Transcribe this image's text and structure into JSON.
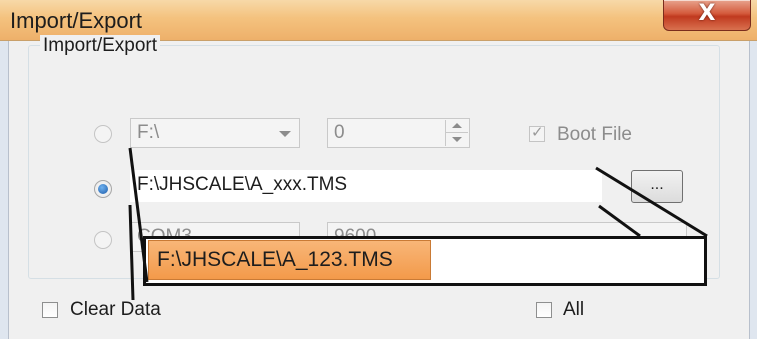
{
  "window": {
    "title": "Import/Export",
    "close_label": "X"
  },
  "group": {
    "label": "Import/Export"
  },
  "row1": {
    "drive_value": "F:\\",
    "number_value": "0",
    "boot_file_label": "Boot File",
    "boot_file_checked": true
  },
  "row2": {
    "path_value": "F:\\JHSCALE\\A_xxx.TMS",
    "browse_label": "..."
  },
  "row3": {
    "port_value": "COM3",
    "baud_value": "9600"
  },
  "callout": {
    "text": "F:\\JHSCALE\\A_123.TMS",
    "highlight_color": "#f5a65b"
  },
  "footer": {
    "clear_data_label": "Clear Data",
    "all_label": "All"
  },
  "colors": {
    "titlebar": "#f4c27e",
    "close_button": "#c0391f",
    "radio_selected": "#1d5ba8"
  }
}
